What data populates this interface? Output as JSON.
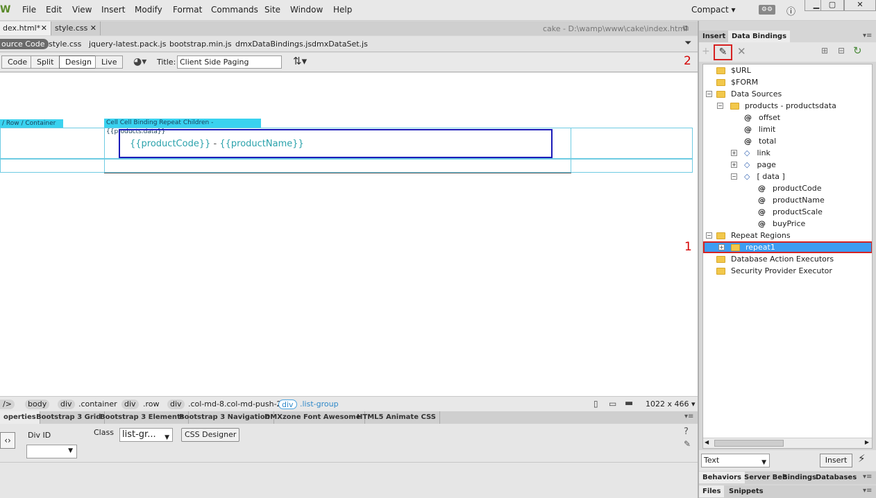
{
  "app": {
    "logo": "W"
  },
  "menu": [
    "File",
    "Edit",
    "View",
    "Insert",
    "Modify",
    "Format",
    "Commands",
    "Site",
    "Window",
    "Help"
  ],
  "workspace": {
    "label": "Compact ▾"
  },
  "doc_tabs": {
    "tab1": "dex.html*",
    "tab2": "style.css",
    "path": "cake - D:\\wamp\\www\\cake\\index.html"
  },
  "related": [
    "ource Code",
    "style.css",
    "jquery-latest.pack.js",
    "bootstrap.min.js",
    "dmxDataBindings.js",
    "dmxDataSet.js"
  ],
  "views": {
    "code": "Code",
    "split": "Split",
    "design": "Design",
    "live": "Live"
  },
  "title": {
    "label": "Title:",
    "value": "Client Side Paging"
  },
  "canvas": {
    "row_label": "/ Row",
    "container_label": "/ Container",
    "cell1": "Cell",
    "cell2": "Cell",
    "binding": "Binding Repeat Children - {{products.data}}",
    "expr1": "{{productCode}}",
    "sep": "-",
    "expr2": "{{productName}}"
  },
  "tagbar": {
    "root": "/>",
    "tags": [
      "body",
      "div",
      "div",
      "div",
      "div"
    ],
    "classes": [
      ".container",
      ".row",
      ".col-md-8.col-md-push-2",
      ".list-group"
    ],
    "size": "1022 x 466 ▾"
  },
  "prop_tabs": [
    "operties",
    "Bootstrap 3 Grid",
    "Bootstrap 3 Elements",
    "Bootstrap 3 Navigation",
    "DMXzone Font Awesome",
    "HTML5 Animate CSS"
  ],
  "props": {
    "divid_label": "Div ID",
    "class_label": "Class",
    "class_value": "list-gr...",
    "css_btn": "CSS Designer"
  },
  "rpanel": {
    "tab_insert": "Insert",
    "tab_bindings": "Data Bindings",
    "type_select": "Text",
    "insert_btn": "Insert"
  },
  "tree": {
    "url": "$URL",
    "form": "$FORM",
    "datasources": "Data Sources",
    "products": "products - productsdata",
    "offset": "offset",
    "limit": "limit",
    "total": "total",
    "link": "link",
    "page": "page",
    "data": "[ data ]",
    "productCode": "productCode",
    "productName": "productName",
    "productScale": "productScale",
    "buyPrice": "buyPrice",
    "repeatregions": "Repeat Regions",
    "repeat1": "repeat1",
    "dbexec": "Database Action Executors",
    "secexec": "Security Provider Executor"
  },
  "bottom_tabs": [
    "Behaviors",
    "Server Beh",
    "Bindings",
    "Databases"
  ],
  "files_tabs": [
    "Files",
    "Snippets"
  ],
  "annotations": {
    "one": "1",
    "two": "2"
  }
}
